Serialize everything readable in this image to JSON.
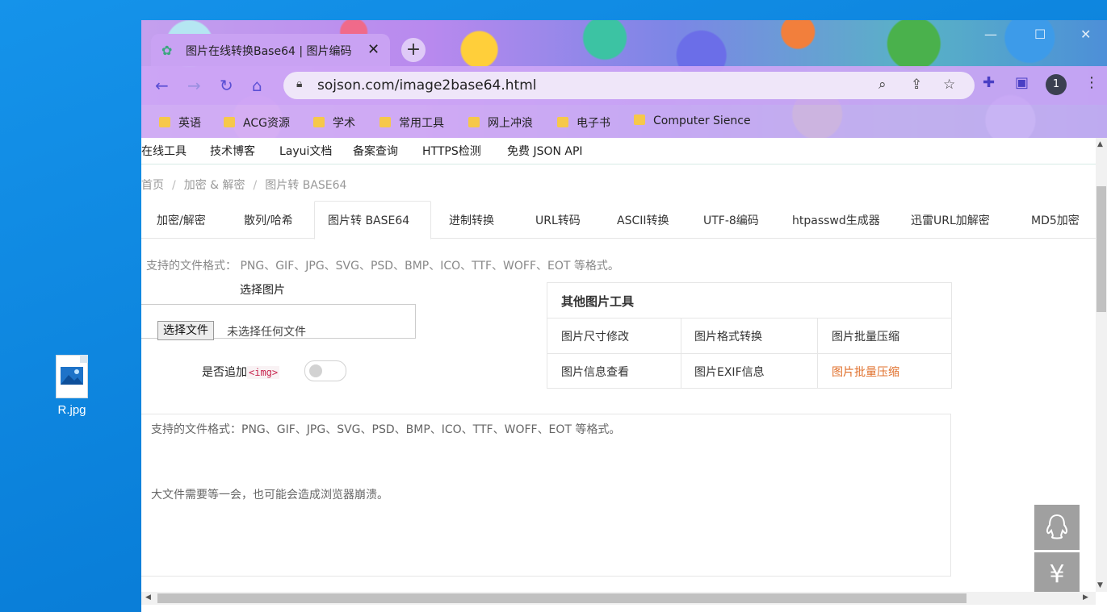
{
  "desktop": {
    "file_label": "R.jpg"
  },
  "browser": {
    "tab_title": "图片在线转换Base64 | 图片编码",
    "url": "sojson.com/image2base64.html",
    "profile_badge": "1",
    "bookmarks": [
      "英语",
      "ACG资源",
      "学术",
      "常用工具",
      "网上冲浪",
      "电子书",
      "Computer Sience"
    ]
  },
  "site": {
    "topnav": [
      "在线工具",
      "技术博客",
      "Layui文档",
      "备案查询",
      "HTTPS检测",
      "免费 JSON API"
    ],
    "breadcrumb": [
      "首页",
      "加密 & 解密",
      "图片转 BASE64"
    ],
    "tabs": [
      "加密/解密",
      "散列/哈希",
      "图片转 BASE64",
      "进制转换",
      "URL转码",
      "ASCII转换",
      "UTF-8编码",
      "htpasswd生成器",
      "迅雷URL加解密",
      "MD5加密"
    ],
    "active_tab": "图片转 BASE64",
    "supported_formats_note": "支持的文件格式： PNG、GIF、JPG、SVG、PSD、BMP、ICO、TTF、WOFF、EOT 等格式。",
    "select_image_title": "选择图片",
    "file_button": "选择文件",
    "no_file_text": "未选择任何文件",
    "append_label": "是否追加",
    "append_tag": "<img>",
    "append_toggle_on": false,
    "other_tools": {
      "title": "其他图片工具",
      "items": [
        "图片尺寸修改",
        "图片格式转换",
        "图片批量压缩",
        "图片信息查看",
        "图片EXIF信息",
        "图片批量压缩"
      ],
      "highlight_color": "#e0702c"
    },
    "textarea_line1": "支持的文件格式：PNG、GIF、JPG、SVG、PSD、BMP、ICO、TTF、WOFF、EOT 等格式。",
    "textarea_line2": "大文件需要等一会，也可能会造成浏览器崩溃。",
    "float_buttons": [
      "qq-icon",
      "yen-icon"
    ]
  }
}
